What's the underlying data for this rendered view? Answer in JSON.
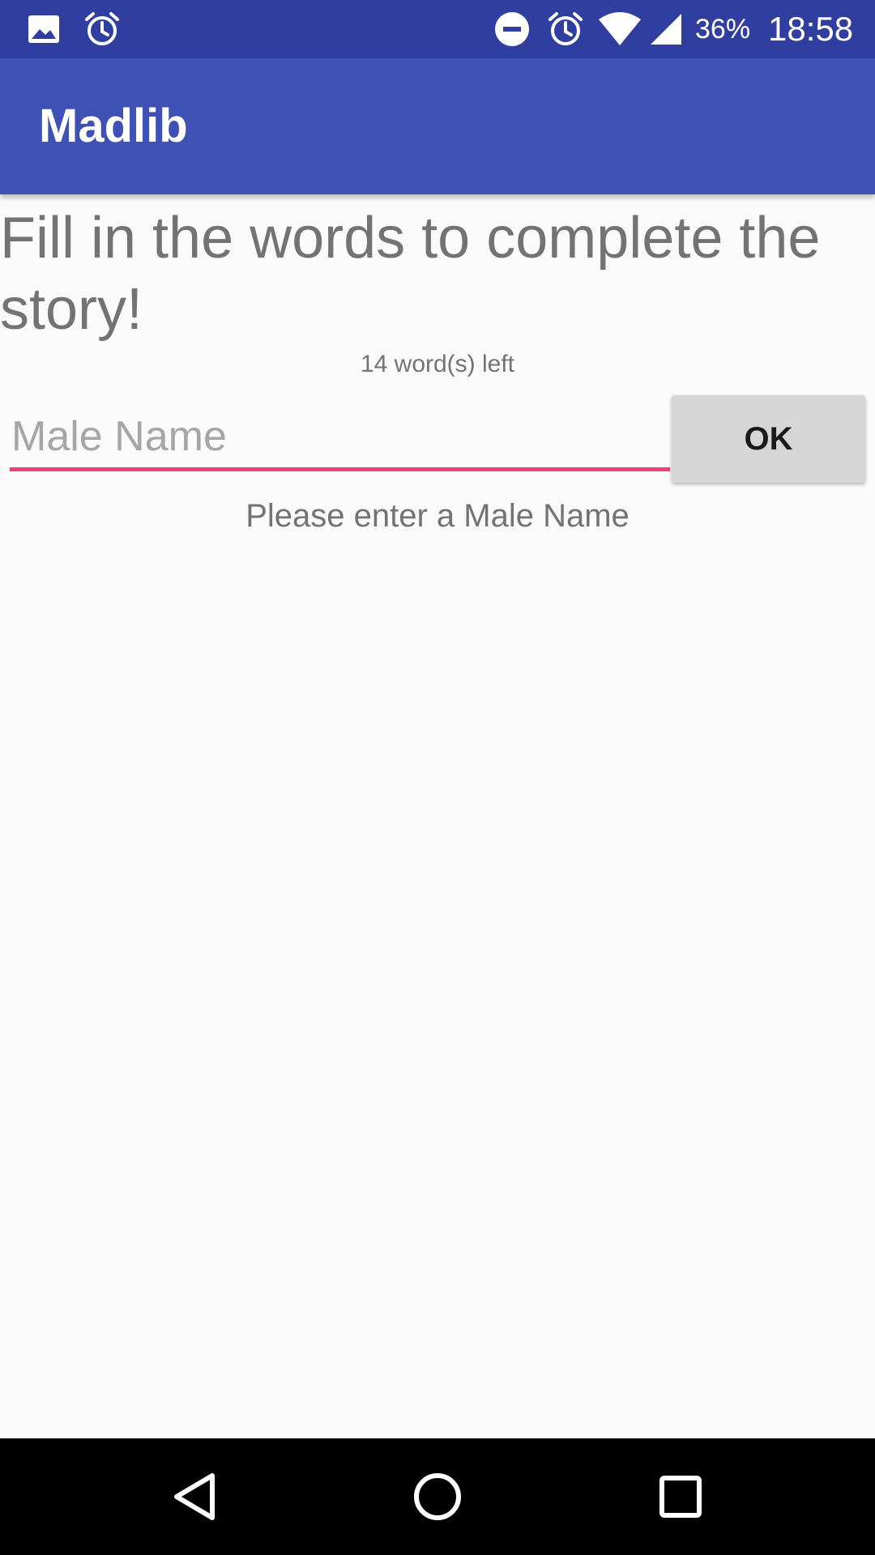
{
  "status_bar": {
    "icons": [
      "image-icon",
      "alarm-icon",
      "do-not-disturb-icon",
      "alarm-icon",
      "wifi-icon",
      "cellular-signal-icon"
    ],
    "battery": "36%",
    "time": "18:58"
  },
  "app_bar": {
    "title": "Madlib"
  },
  "main": {
    "heading": "Fill in the words to complete the story!",
    "words_left": "14 word(s) left",
    "input": {
      "value": "",
      "placeholder": "Male Name"
    },
    "ok_label": "OK",
    "prompt": "Please enter a Male Name"
  },
  "nav_bar": {
    "icons": [
      "back-icon",
      "home-icon",
      "recents-icon"
    ]
  },
  "colors": {
    "status_bar": "#303f9f",
    "primary": "#3f51b5",
    "accent": "#ec407a",
    "background": "#fafafa"
  }
}
